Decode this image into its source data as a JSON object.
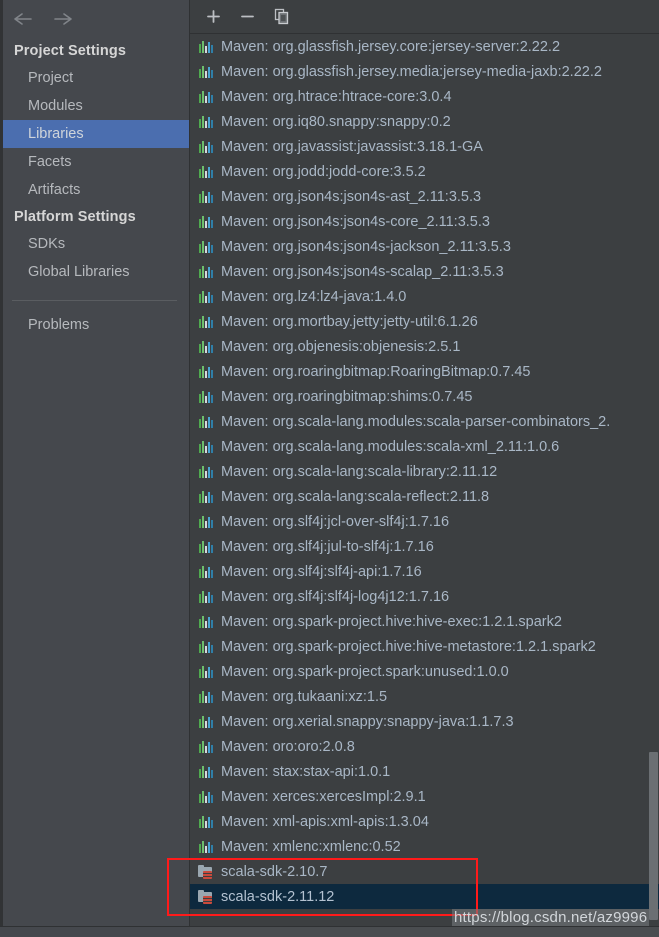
{
  "sidebar": {
    "nav": {
      "back_icon": "arrow-left-icon",
      "forward_icon": "arrow-right-icon"
    },
    "sections": [
      {
        "title": "Project Settings",
        "items": [
          {
            "label": "Project",
            "selected": false
          },
          {
            "label": "Modules",
            "selected": false
          },
          {
            "label": "Libraries",
            "selected": true
          },
          {
            "label": "Facets",
            "selected": false
          },
          {
            "label": "Artifacts",
            "selected": false
          }
        ]
      },
      {
        "title": "Platform Settings",
        "items": [
          {
            "label": "SDKs",
            "selected": false
          },
          {
            "label": "Global Libraries",
            "selected": false
          }
        ]
      }
    ],
    "extra_items": [
      {
        "label": "Problems",
        "selected": false
      }
    ]
  },
  "toolbar": {
    "add_label": "+",
    "remove_label": "−",
    "copy_label": "Copy",
    "buttons": [
      {
        "name": "add-button",
        "icon": "plus-icon"
      },
      {
        "name": "remove-button",
        "icon": "minus-icon"
      },
      {
        "name": "copy-button",
        "icon": "copy-icon"
      }
    ]
  },
  "library_list": {
    "rows": [
      {
        "icon": "maven-icon",
        "label": "Maven: org.glassfish.jersey.core:jersey-server:2.22.2",
        "selected": false
      },
      {
        "icon": "maven-icon",
        "label": "Maven: org.glassfish.jersey.media:jersey-media-jaxb:2.22.2",
        "selected": false
      },
      {
        "icon": "maven-icon",
        "label": "Maven: org.htrace:htrace-core:3.0.4",
        "selected": false
      },
      {
        "icon": "maven-icon",
        "label": "Maven: org.iq80.snappy:snappy:0.2",
        "selected": false
      },
      {
        "icon": "maven-icon",
        "label": "Maven: org.javassist:javassist:3.18.1-GA",
        "selected": false
      },
      {
        "icon": "maven-icon",
        "label": "Maven: org.jodd:jodd-core:3.5.2",
        "selected": false
      },
      {
        "icon": "maven-icon",
        "label": "Maven: org.json4s:json4s-ast_2.11:3.5.3",
        "selected": false
      },
      {
        "icon": "maven-icon",
        "label": "Maven: org.json4s:json4s-core_2.11:3.5.3",
        "selected": false
      },
      {
        "icon": "maven-icon",
        "label": "Maven: org.json4s:json4s-jackson_2.11:3.5.3",
        "selected": false
      },
      {
        "icon": "maven-icon",
        "label": "Maven: org.json4s:json4s-scalap_2.11:3.5.3",
        "selected": false
      },
      {
        "icon": "maven-icon",
        "label": "Maven: org.lz4:lz4-java:1.4.0",
        "selected": false
      },
      {
        "icon": "maven-icon",
        "label": "Maven: org.mortbay.jetty:jetty-util:6.1.26",
        "selected": false
      },
      {
        "icon": "maven-icon",
        "label": "Maven: org.objenesis:objenesis:2.5.1",
        "selected": false
      },
      {
        "icon": "maven-icon",
        "label": "Maven: org.roaringbitmap:RoaringBitmap:0.7.45",
        "selected": false
      },
      {
        "icon": "maven-icon",
        "label": "Maven: org.roaringbitmap:shims:0.7.45",
        "selected": false
      },
      {
        "icon": "maven-icon",
        "label": "Maven: org.scala-lang.modules:scala-parser-combinators_2.",
        "selected": false
      },
      {
        "icon": "maven-icon",
        "label": "Maven: org.scala-lang.modules:scala-xml_2.11:1.0.6",
        "selected": false
      },
      {
        "icon": "maven-icon",
        "label": "Maven: org.scala-lang:scala-library:2.11.12",
        "selected": false
      },
      {
        "icon": "maven-icon",
        "label": "Maven: org.scala-lang:scala-reflect:2.11.8",
        "selected": false
      },
      {
        "icon": "maven-icon",
        "label": "Maven: org.slf4j:jcl-over-slf4j:1.7.16",
        "selected": false
      },
      {
        "icon": "maven-icon",
        "label": "Maven: org.slf4j:jul-to-slf4j:1.7.16",
        "selected": false
      },
      {
        "icon": "maven-icon",
        "label": "Maven: org.slf4j:slf4j-api:1.7.16",
        "selected": false
      },
      {
        "icon": "maven-icon",
        "label": "Maven: org.slf4j:slf4j-log4j12:1.7.16",
        "selected": false
      },
      {
        "icon": "maven-icon",
        "label": "Maven: org.spark-project.hive:hive-exec:1.2.1.spark2",
        "selected": false
      },
      {
        "icon": "maven-icon",
        "label": "Maven: org.spark-project.hive:hive-metastore:1.2.1.spark2",
        "selected": false
      },
      {
        "icon": "maven-icon",
        "label": "Maven: org.spark-project.spark:unused:1.0.0",
        "selected": false
      },
      {
        "icon": "maven-icon",
        "label": "Maven: org.tukaani:xz:1.5",
        "selected": false
      },
      {
        "icon": "maven-icon",
        "label": "Maven: org.xerial.snappy:snappy-java:1.1.7.3",
        "selected": false
      },
      {
        "icon": "maven-icon",
        "label": "Maven: oro:oro:2.0.8",
        "selected": false
      },
      {
        "icon": "maven-icon",
        "label": "Maven: stax:stax-api:1.0.1",
        "selected": false
      },
      {
        "icon": "maven-icon",
        "label": "Maven: xerces:xercesImpl:2.9.1",
        "selected": false
      },
      {
        "icon": "maven-icon",
        "label": "Maven: xml-apis:xml-apis:1.3.04",
        "selected": false
      },
      {
        "icon": "maven-icon",
        "label": "Maven: xmlenc:xmlenc:0.52",
        "selected": false
      },
      {
        "icon": "sdk-icon",
        "label": "scala-sdk-2.10.7",
        "selected": false
      },
      {
        "icon": "sdk-icon",
        "label": "scala-sdk-2.11.12",
        "selected": true
      }
    ]
  },
  "annotation": {
    "highlight_color": "#ff1a1a",
    "watermark_text": "https://blog.csdn.net/az9996"
  },
  "colors": {
    "window_bg": "#3c3f41",
    "sidebar_bg": "#45484d",
    "sidebar_selected": "#4b6eaf",
    "row_selected": "#0d293e",
    "text": "#a9b7c6",
    "heading_text": "#d6d6d6"
  }
}
